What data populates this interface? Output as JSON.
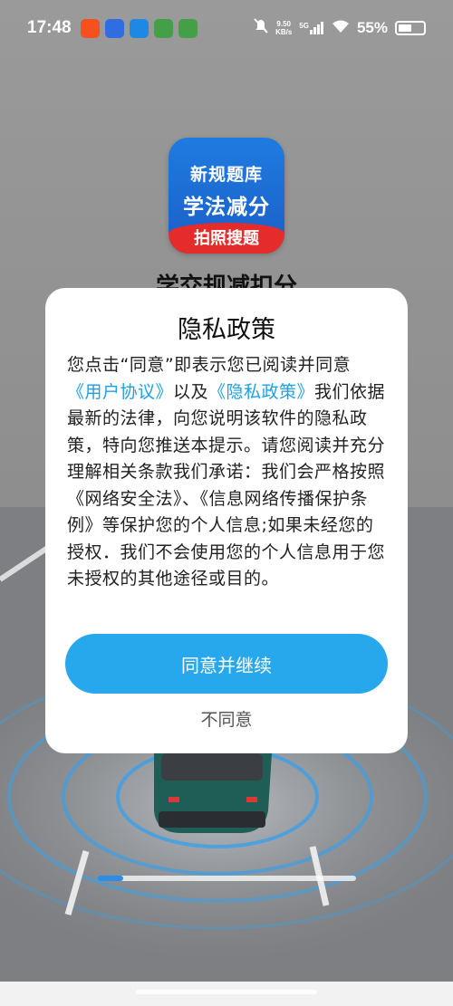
{
  "status_bar": {
    "time": "17:48",
    "net_speed_value": "9.50",
    "net_speed_unit": "KB/s",
    "signal": "5G",
    "battery_percent": "55%",
    "battery_level": 0.55,
    "app_icons": [
      "taobao-app-icon",
      "baidu-app-icon",
      "browser-app-icon",
      "app-store-icon",
      "app-store-icon-2"
    ]
  },
  "logo": {
    "line1": "新规题库",
    "line2": "学法减分",
    "band": "拍照搜题"
  },
  "app_title": "学交规减扣分",
  "dialog": {
    "title": "隐私政策",
    "text_1": "您点击“同意”即表示您已阅读并同意",
    "user_agreement_link": "《用户协议》",
    "text_2": "以及",
    "privacy_policy_link": "《隐私政策》",
    "text_3": "我们依据最新的法律，向您说明该软件的隐私政策，特向您推送本提示。请您阅读并充分理解相关条款我们承诺：我们会严格按照《网络安全法》、《信息网络传播保护条例》等保护您的个人信息;如果未经您的授权．我们不会使用您的个人信息用于您未授权的其他途径或目的。",
    "agree_button": "同意并继续",
    "disagree_button": "不同意"
  },
  "splash_progress": 0.1,
  "colors": {
    "accent": "#27a7ec",
    "link": "#1ea0e8",
    "logo_blue": "#1f7be0",
    "logo_red": "#e62b2b"
  }
}
